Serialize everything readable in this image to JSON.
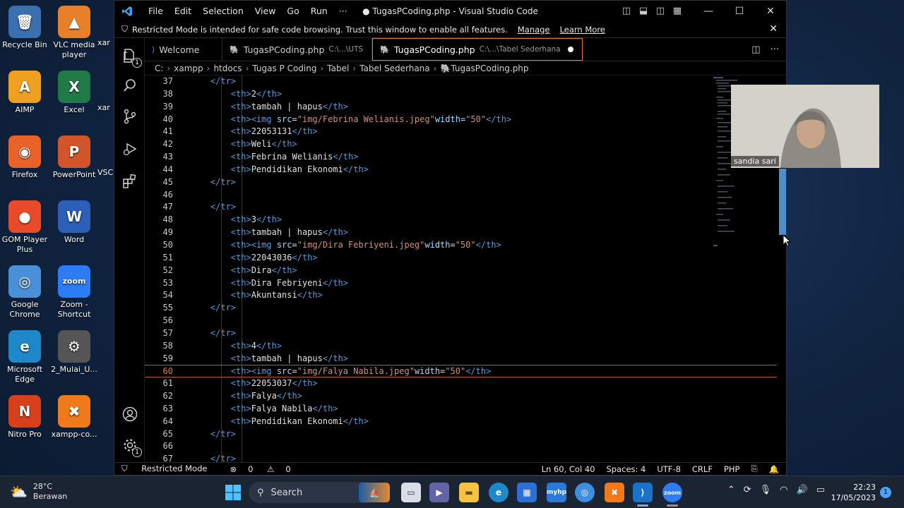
{
  "desktop": {
    "icons": [
      {
        "label": "Recycle Bin",
        "glyph": "🗑",
        "color": "#3a6fb0"
      },
      {
        "label": "VLC media player",
        "glyph": "▲",
        "color": "#e8802a"
      },
      {
        "label": "AIMP",
        "glyph": "A",
        "color": "#f0a020"
      },
      {
        "label": "Excel",
        "glyph": "X",
        "color": "#1f7a45"
      },
      {
        "label": "Firefox",
        "glyph": "◉",
        "color": "#e8622a"
      },
      {
        "label": "PowerPoint",
        "glyph": "P",
        "color": "#d2542a"
      },
      {
        "label": "GOM Player Plus",
        "glyph": "●",
        "color": "#e84a2a"
      },
      {
        "label": "Word",
        "glyph": "W",
        "color": "#2b5fb8"
      },
      {
        "label": "Google Chrome",
        "glyph": "◎",
        "color": "#4a90d9"
      },
      {
        "label": "Zoom - Shortcut",
        "glyph": "zoom",
        "color": "#2d7cf6"
      },
      {
        "label": "Microsoft Edge",
        "glyph": "e",
        "color": "#1e88c8"
      },
      {
        "label": "2_Mulai_U...",
        "glyph": "⚙",
        "color": "#555"
      },
      {
        "label": "Nitro Pro",
        "glyph": "N",
        "color": "#d8401c"
      },
      {
        "label": "xampp-co...",
        "glyph": "✖",
        "color": "#f07a1a"
      }
    ],
    "partial_labels": [
      "xar",
      "xar",
      "VSC"
    ]
  },
  "vscode": {
    "menu": [
      "File",
      "Edit",
      "Selection",
      "View",
      "Go",
      "Run",
      "···"
    ],
    "window_title": "● TugasPCoding.php - Visual Studio Code",
    "banner": {
      "text": "Restricted Mode is intended for safe code browsing. Trust this window to enable all features.",
      "manage": "Manage",
      "learn_more": "Learn More"
    },
    "tabs": [
      {
        "label": "Welcome",
        "path": "",
        "icon": "vs-icon",
        "active": false
      },
      {
        "label": "TugasPCoding.php",
        "path": "C:\\...\\UTS",
        "icon": "php-icon",
        "active": false
      },
      {
        "label": "TugasPCoding.php",
        "path": "C:\\...\\Tabel Sederhana",
        "icon": "php-icon",
        "active": true
      }
    ],
    "breadcrumb": [
      "C:",
      "xampp",
      "htdocs",
      "Tugas P Coding",
      "Tabel",
      "Tabel Sederhana",
      "TugasPCoding.php"
    ],
    "activity_badges": {
      "explorer": "1",
      "settings": "1"
    },
    "code_lines": [
      {
        "n": "37",
        "indent": 1,
        "parts": [
          [
            "tag",
            "</tr>"
          ]
        ]
      },
      {
        "n": "38",
        "indent": 2,
        "parts": [
          [
            "tag",
            "<th>"
          ],
          [
            "txt",
            "2"
          ],
          [
            "tag",
            "</th>"
          ]
        ]
      },
      {
        "n": "39",
        "indent": 2,
        "parts": [
          [
            "tag",
            "<th>"
          ],
          [
            "txt",
            "tambah | hapus"
          ],
          [
            "tag",
            "</th>"
          ]
        ]
      },
      {
        "n": "40",
        "indent": 2,
        "parts": [
          [
            "tag",
            "<th><img "
          ],
          [
            "attr",
            "src"
          ],
          [
            "txt",
            "="
          ],
          [
            "str",
            "\"img/Febrina Welianis.jpeg\""
          ],
          [
            "attr",
            "width"
          ],
          [
            "txt",
            "="
          ],
          [
            "str",
            "\"50\""
          ],
          [
            "tag",
            "</th>"
          ]
        ]
      },
      {
        "n": "41",
        "indent": 2,
        "parts": [
          [
            "tag",
            "<th>"
          ],
          [
            "txt",
            "22053131"
          ],
          [
            "tag",
            "</th>"
          ]
        ]
      },
      {
        "n": "42",
        "indent": 2,
        "parts": [
          [
            "tag",
            "<th>"
          ],
          [
            "txt",
            "Weli"
          ],
          [
            "tag",
            "</th>"
          ]
        ]
      },
      {
        "n": "43",
        "indent": 2,
        "parts": [
          [
            "tag",
            "<th>"
          ],
          [
            "txt",
            "Febrina Welianis"
          ],
          [
            "tag",
            "</th>"
          ]
        ]
      },
      {
        "n": "44",
        "indent": 2,
        "parts": [
          [
            "tag",
            "<th>"
          ],
          [
            "txt",
            "Pendidikan Ekonomi"
          ],
          [
            "tag",
            "</th>"
          ]
        ]
      },
      {
        "n": "45",
        "indent": 1,
        "parts": [
          [
            "tag",
            "</tr>"
          ]
        ]
      },
      {
        "n": "46",
        "indent": 0,
        "parts": []
      },
      {
        "n": "47",
        "indent": 1,
        "parts": [
          [
            "tag",
            "</tr>"
          ]
        ]
      },
      {
        "n": "48",
        "indent": 2,
        "parts": [
          [
            "tag",
            "<th>"
          ],
          [
            "txt",
            "3"
          ],
          [
            "tag",
            "</th>"
          ]
        ]
      },
      {
        "n": "49",
        "indent": 2,
        "parts": [
          [
            "tag",
            "<th>"
          ],
          [
            "txt",
            "tambah | hapus"
          ],
          [
            "tag",
            "</th>"
          ]
        ]
      },
      {
        "n": "50",
        "indent": 2,
        "parts": [
          [
            "tag",
            "<th><img "
          ],
          [
            "attr",
            "src"
          ],
          [
            "txt",
            "="
          ],
          [
            "str",
            "\"img/Dira Febriyeni.jpeg\""
          ],
          [
            "attr",
            "width"
          ],
          [
            "txt",
            "="
          ],
          [
            "str",
            "\"50\""
          ],
          [
            "tag",
            "</th>"
          ]
        ]
      },
      {
        "n": "51",
        "indent": 2,
        "parts": [
          [
            "tag",
            "<th>"
          ],
          [
            "txt",
            "22043036"
          ],
          [
            "tag",
            "</th>"
          ]
        ]
      },
      {
        "n": "52",
        "indent": 2,
        "parts": [
          [
            "tag",
            "<th>"
          ],
          [
            "txt",
            "Dira"
          ],
          [
            "tag",
            "</th>"
          ]
        ]
      },
      {
        "n": "53",
        "indent": 2,
        "parts": [
          [
            "tag",
            "<th>"
          ],
          [
            "txt",
            "Dira Febriyeni"
          ],
          [
            "tag",
            "</th>"
          ]
        ]
      },
      {
        "n": "54",
        "indent": 2,
        "parts": [
          [
            "tag",
            "<th>"
          ],
          [
            "txt",
            "Akuntansi"
          ],
          [
            "tag",
            "</th>"
          ]
        ]
      },
      {
        "n": "55",
        "indent": 1,
        "parts": [
          [
            "tag",
            "</tr>"
          ]
        ]
      },
      {
        "n": "56",
        "indent": 0,
        "parts": []
      },
      {
        "n": "57",
        "indent": 1,
        "parts": [
          [
            "tag",
            "</tr>"
          ]
        ]
      },
      {
        "n": "58",
        "indent": 2,
        "parts": [
          [
            "tag",
            "<th>"
          ],
          [
            "txt",
            "4"
          ],
          [
            "tag",
            "</th>"
          ]
        ]
      },
      {
        "n": "59",
        "indent": 2,
        "parts": [
          [
            "tag",
            "<th>"
          ],
          [
            "txt",
            "tambah | hapus"
          ],
          [
            "tag",
            "</th>"
          ]
        ]
      },
      {
        "n": "60",
        "indent": 2,
        "current": true,
        "parts": [
          [
            "tag",
            "<th><img "
          ],
          [
            "attr",
            "src"
          ],
          [
            "txt",
            "="
          ],
          [
            "str",
            "\"img/Falya Nabila.jpeg\""
          ],
          [
            "attr",
            "width"
          ],
          [
            "txt",
            "="
          ],
          [
            "str",
            "\"50\""
          ],
          [
            "tag",
            "</th>"
          ]
        ]
      },
      {
        "n": "61",
        "indent": 2,
        "parts": [
          [
            "tag",
            "<th>"
          ],
          [
            "txt",
            "22053037"
          ],
          [
            "tag",
            "</th>"
          ]
        ]
      },
      {
        "n": "62",
        "indent": 2,
        "parts": [
          [
            "tag",
            "<th>"
          ],
          [
            "txt",
            "Falya"
          ],
          [
            "tag",
            "</th>"
          ]
        ]
      },
      {
        "n": "63",
        "indent": 2,
        "parts": [
          [
            "tag",
            "<th>"
          ],
          [
            "txt",
            "Falya Nabila"
          ],
          [
            "tag",
            "</th>"
          ]
        ]
      },
      {
        "n": "64",
        "indent": 2,
        "parts": [
          [
            "tag",
            "<th>"
          ],
          [
            "txt",
            "Pendidikan Ekonomi"
          ],
          [
            "tag",
            "</th>"
          ]
        ]
      },
      {
        "n": "65",
        "indent": 1,
        "parts": [
          [
            "tag",
            "</tr>"
          ]
        ]
      },
      {
        "n": "66",
        "indent": 0,
        "parts": []
      },
      {
        "n": "67",
        "indent": 1,
        "parts": [
          [
            "tag",
            "</tr>"
          ]
        ]
      }
    ],
    "status": {
      "restricted": "Restricted Mode",
      "errors": "0",
      "warnings": "0",
      "position": "Ln 60, Col 40",
      "spaces": "Spaces: 4",
      "encoding": "UTF-8",
      "eol": "CRLF",
      "language": "PHP"
    }
  },
  "webcam": {
    "name": "sandia sari"
  },
  "taskbar": {
    "temperature": "28°C",
    "weather": "Berawan",
    "search_label": "Search",
    "time": "22:23",
    "date": "17/05/2023",
    "notifications": "1"
  },
  "colors": {
    "accent": "#e8772e",
    "tag": "#569cd6",
    "string": "#ce9178",
    "attr": "#9cdcfe"
  }
}
